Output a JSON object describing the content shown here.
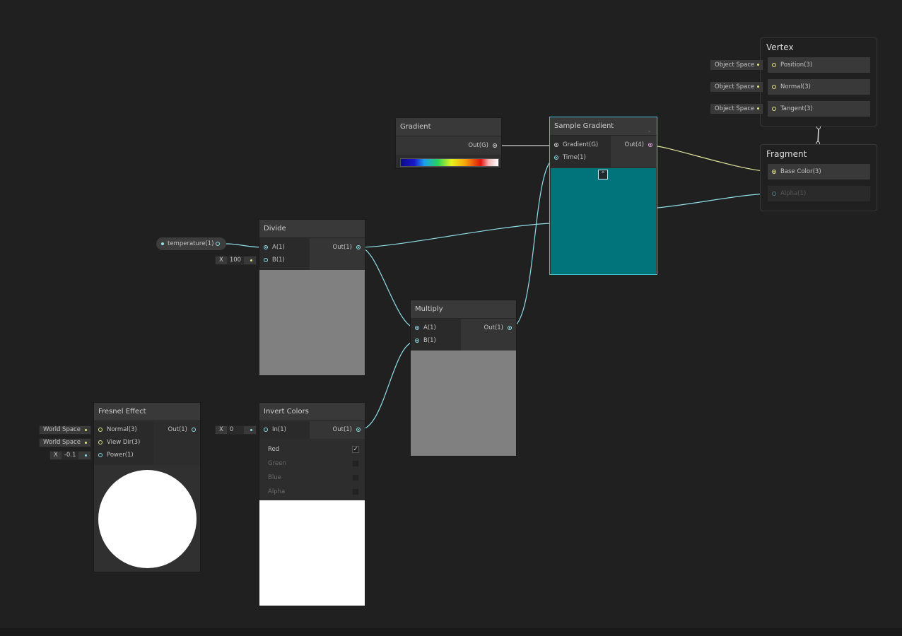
{
  "colors": {
    "canvas": "#202020",
    "port_float": "#8fdfe8",
    "port_vector3": "#e4ea8a",
    "port_vector4": "#e6a8e4",
    "sample_preview": "#01737a",
    "gray_preview": "#808080"
  },
  "property": {
    "label": "temperature(1)"
  },
  "nodes": {
    "gradient": {
      "title": "Gradient",
      "out": "Out(G)"
    },
    "sample_gradient": {
      "title": "Sample Gradient",
      "in1": "Gradient(G)",
      "in2": "Time(1)",
      "out": "Out(4)"
    },
    "divide": {
      "title": "Divide",
      "in1": "A(1)",
      "in2": "B(1)",
      "out": "Out(1)",
      "b_field": {
        "label": "X",
        "value": "100"
      }
    },
    "multiply": {
      "title": "Multiply",
      "in1": "A(1)",
      "in2": "B(1)",
      "out": "Out(1)"
    },
    "invert_colors": {
      "title": "Invert Colors",
      "in": "In(1)",
      "out": "Out(1)",
      "in_field": {
        "label": "X",
        "value": "0"
      },
      "toggles": [
        {
          "label": "Red",
          "checked": true
        },
        {
          "label": "Green",
          "checked": false
        },
        {
          "label": "Blue",
          "checked": false
        },
        {
          "label": "Alpha",
          "checked": false
        }
      ]
    },
    "fresnel": {
      "title": "Fresnel Effect",
      "in1": "Normal(3)",
      "in2": "View Dir(3)",
      "in3": "Power(1)",
      "out": "Out(1)",
      "normal_field": "World Space",
      "viewdir_field": "World Space",
      "power_field": {
        "label": "X",
        "value": "-0.1"
      }
    }
  },
  "master": {
    "vertex": {
      "title": "Vertex",
      "slots": [
        {
          "label": "Position(3)",
          "space": "Object Space"
        },
        {
          "label": "Normal(3)",
          "space": "Object Space"
        },
        {
          "label": "Tangent(3)",
          "space": "Object Space"
        }
      ]
    },
    "fragment": {
      "title": "Fragment",
      "slots": [
        {
          "label": "Base Color(3)"
        },
        {
          "label": "Alpha(1)"
        }
      ]
    }
  }
}
